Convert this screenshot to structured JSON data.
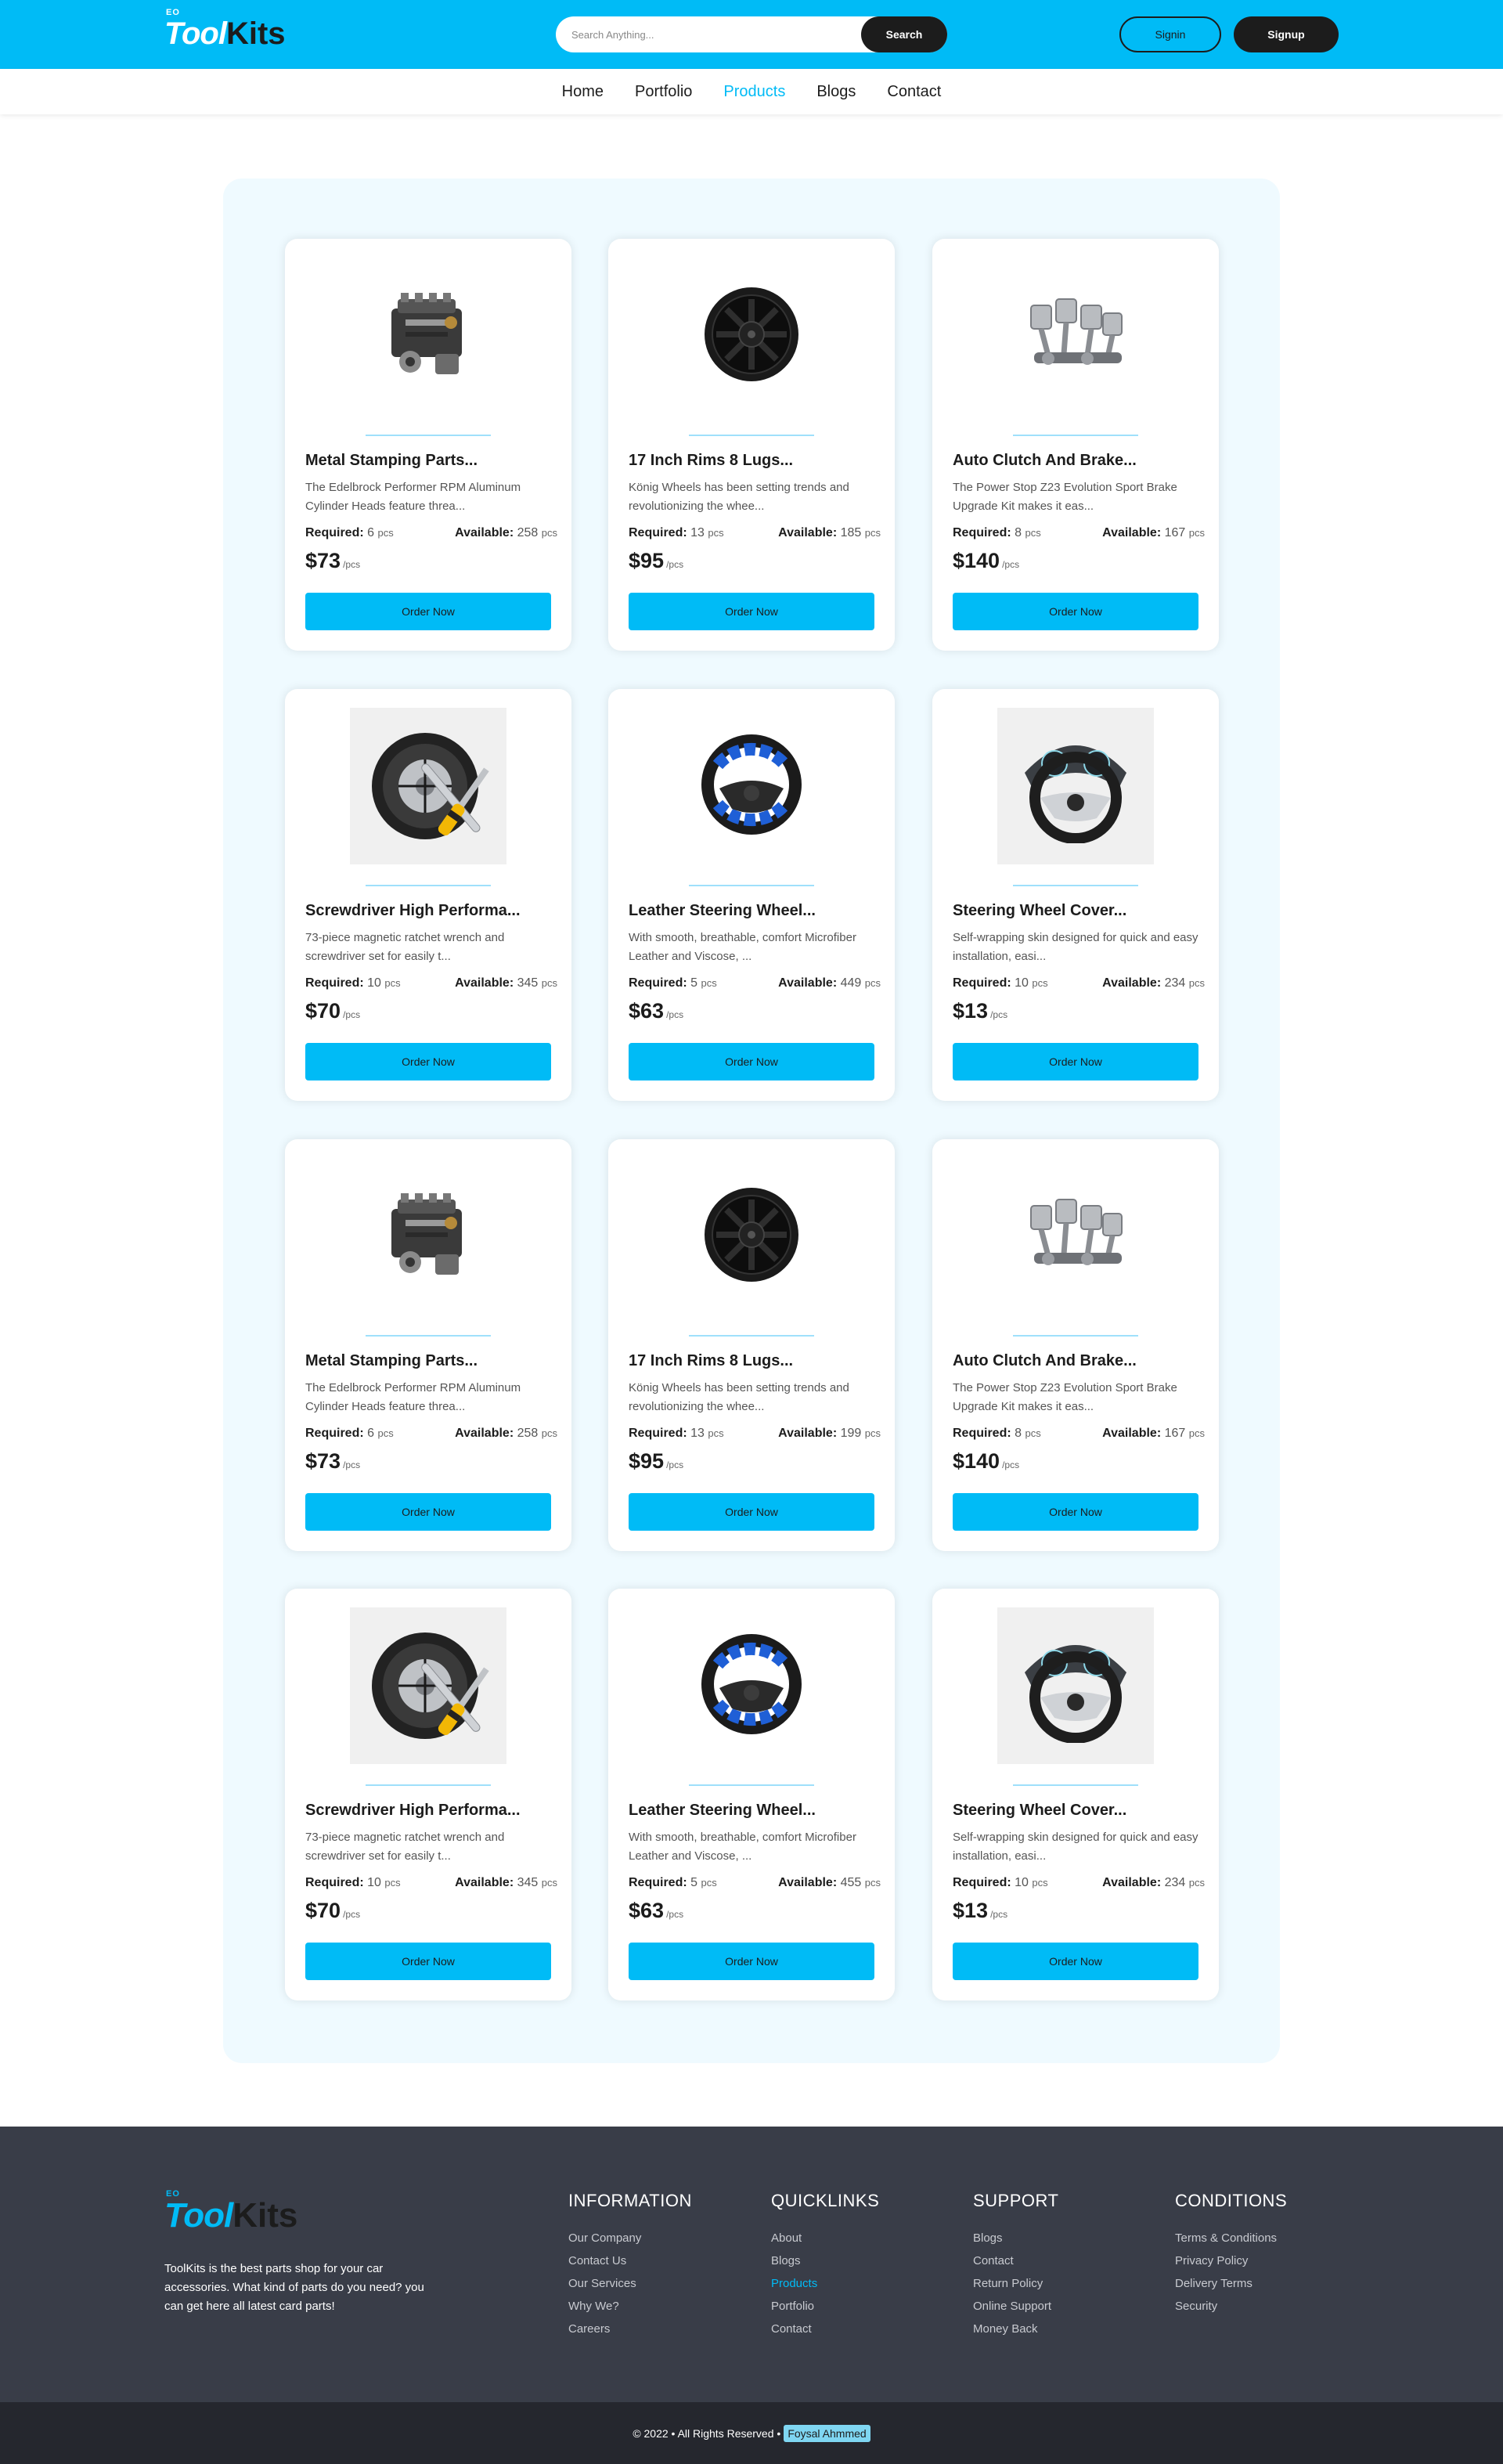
{
  "header": {
    "logo": {
      "badge": "EO",
      "tool": "Tool",
      "kits": "Kits"
    },
    "search": {
      "placeholder": "Search Anything...",
      "button": "Search"
    },
    "signin": "Signin",
    "signup": "Signup"
  },
  "nav": {
    "items": [
      "Home",
      "Portfolio",
      "Products",
      "Blogs",
      "Contact"
    ],
    "active": "Products"
  },
  "products": [
    {
      "title": "Metal Stamping Parts...",
      "description": "The Edelbrock Performer RPM Aluminum Cylinder Heads feature threa...",
      "required": "6",
      "available": "258",
      "price": "$73",
      "image": "engine-block"
    },
    {
      "title": "17 Inch Rims 8 Lugs...",
      "description": "König Wheels has been setting trends and revolutionizing the whee...",
      "required": "13",
      "available": "185",
      "price": "$95",
      "image": "black-rim"
    },
    {
      "title": "Auto Clutch And Brake...",
      "description": "The Power Stop Z23 Evolution Sport Brake Upgrade Kit makes it eas...",
      "required": "8",
      "available": "167",
      "price": "$140",
      "image": "pistons"
    },
    {
      "title": "Screwdriver High Performa...",
      "description": "73-piece magnetic ratchet wrench and screwdriver set for easily t...",
      "required": "10",
      "available": "345",
      "price": "$70",
      "image": "tire-and-tools"
    },
    {
      "title": "Leather Steering Wheel...",
      "description": "With smooth, breathable, comfort Microfiber Leather and Viscose, ...",
      "required": "5",
      "available": "449",
      "price": "$63",
      "image": "blue-steering-cover"
    },
    {
      "title": "Steering Wheel Cover...",
      "description": "Self-wrapping skin designed for quick and easy installation, easi...",
      "required": "10",
      "available": "234",
      "price": "$13",
      "image": "steering-wheel-dash"
    },
    {
      "title": "Metal Stamping Parts...",
      "description": "The Edelbrock Performer RPM Aluminum Cylinder Heads feature threa...",
      "required": "6",
      "available": "258",
      "price": "$73",
      "image": "engine-block"
    },
    {
      "title": "17 Inch Rims 8 Lugs...",
      "description": "König Wheels has been setting trends and revolutionizing the whee...",
      "required": "13",
      "available": "199",
      "price": "$95",
      "image": "black-rim"
    },
    {
      "title": "Auto Clutch And Brake...",
      "description": "The Power Stop Z23 Evolution Sport Brake Upgrade Kit makes it eas...",
      "required": "8",
      "available": "167",
      "price": "$140",
      "image": "pistons"
    },
    {
      "title": "Screwdriver High Performa...",
      "description": "73-piece magnetic ratchet wrench and screwdriver set for easily t...",
      "required": "10",
      "available": "345",
      "price": "$70",
      "image": "tire-and-tools"
    },
    {
      "title": "Leather Steering Wheel...",
      "description": "With smooth, breathable, comfort Microfiber Leather and Viscose, ...",
      "required": "5",
      "available": "455",
      "price": "$63",
      "image": "blue-steering-cover"
    },
    {
      "title": "Steering Wheel Cover...",
      "description": "Self-wrapping skin designed for quick and easy installation, easi...",
      "required": "10",
      "available": "234",
      "price": "$13",
      "image": "steering-wheel-dash"
    }
  ],
  "card_labels": {
    "required": "Required:",
    "available": "Available:",
    "unit": "pcs",
    "per_unit": "/pcs",
    "order": "Order Now"
  },
  "footer": {
    "about": "ToolKits is the best parts shop for your car accessories. What kind of parts do you need? you can get here all latest card parts!",
    "columns": [
      {
        "heading": "INFORMATION",
        "links": [
          "Our Company",
          "Contact Us",
          "Our Services",
          "Why We?",
          "Careers"
        ]
      },
      {
        "heading": "QUICKLINKS",
        "links": [
          "About",
          "Blogs",
          "Products",
          "Portfolio",
          "Contact"
        ]
      },
      {
        "heading": "SUPPORT",
        "links": [
          "Blogs",
          "Contact",
          "Return Policy",
          "Online Support",
          "Money Back"
        ]
      },
      {
        "heading": "CONDITIONS",
        "links": [
          "Terms & Conditions",
          "Privacy Policy",
          "Delivery Terms",
          "Security"
        ]
      }
    ],
    "active_link": "Products"
  },
  "copyright": {
    "text": "© 2022 • All Rights Reserved •",
    "author": "Foysal Ahmmed"
  },
  "colors": {
    "brand": "#00bbf6",
    "dark": "#1c1c1c",
    "panel": "#effaff",
    "footer": "#393d48",
    "bottom": "#25272e"
  }
}
